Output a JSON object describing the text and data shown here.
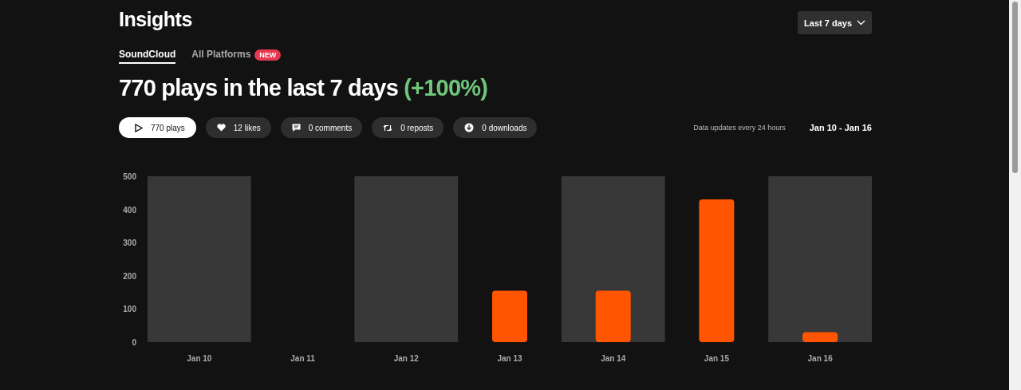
{
  "title": "Insights",
  "range_dropdown": {
    "label": "Last 7 days"
  },
  "tabs": [
    {
      "label": "SoundCloud",
      "selected": true
    },
    {
      "label": "All Platforms",
      "selected": false,
      "badge": "NEW"
    }
  ],
  "headline": {
    "text": "770 plays in the last 7 days",
    "change": "(+100%)"
  },
  "metrics": [
    {
      "label": "770 plays",
      "kind": "plays",
      "selected": true
    },
    {
      "label": "12 likes",
      "kind": "likes",
      "selected": false
    },
    {
      "label": "0 comments",
      "kind": "comments",
      "selected": false
    },
    {
      "label": "0 reposts",
      "kind": "reposts",
      "selected": false
    },
    {
      "label": "0 downloads",
      "kind": "downloads",
      "selected": false
    }
  ],
  "update_note": "Data updates every 24 hours",
  "date_range": "Jan 10 - Jan 16",
  "chart_data": {
    "type": "bar",
    "categories": [
      "Jan 10",
      "Jan 11",
      "Jan 12",
      "Jan 13",
      "Jan 14",
      "Jan 15",
      "Jan 16"
    ],
    "values": [
      0,
      0,
      0,
      155,
      155,
      430,
      30
    ],
    "ylim": [
      0,
      500
    ],
    "yticks": [
      0,
      100,
      200,
      300,
      400,
      500
    ]
  }
}
